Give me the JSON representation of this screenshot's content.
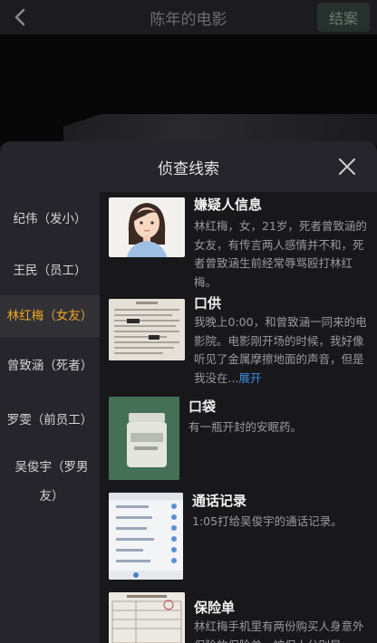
{
  "header": {
    "title": "陈年的电影",
    "end_button": "结案",
    "back_icon": "chevron-left-icon"
  },
  "panel": {
    "title": "侦查线索",
    "close_icon": "close-icon"
  },
  "sidebar": {
    "items": [
      {
        "label": "纪伟（发小）"
      },
      {
        "label": "王民（员工）"
      },
      {
        "label": "林红梅（女友）"
      },
      {
        "label": "曾致涵（死者）"
      },
      {
        "label": "罗雯（前员工）"
      },
      {
        "label": "吴俊宇（罗男友）"
      }
    ],
    "active_index": 2,
    "active_color": "#f0a626"
  },
  "clues": [
    {
      "title": "嫌疑人信息",
      "desc": "林红梅，女，21岁，死者曾致涵的女友，有传言两人感情并不和，死者曾致涵生前经常辱骂殴打林红梅。",
      "thumb": "woman-portrait"
    },
    {
      "title": "口供",
      "desc": "我晚上0:00，和曾致涵一同来的电影院。电影刚开场的时候，我好像听见了金属摩擦地面的声音，但是我没在...",
      "expand": "展开",
      "thumb": "handwritten-statement"
    },
    {
      "title": "口袋",
      "desc": "有一瓶开封的安眠药。",
      "thumb": "pill-bottle"
    },
    {
      "title": "通话记录",
      "desc": "1:05打给吴俊宇的通话记录。",
      "thumb": "phone-call-log"
    },
    {
      "title": "保险单",
      "desc": "林红梅手机里有两份购买人身意外保险的保险单，被保人分别是",
      "thumb": "insurance-form"
    }
  ]
}
